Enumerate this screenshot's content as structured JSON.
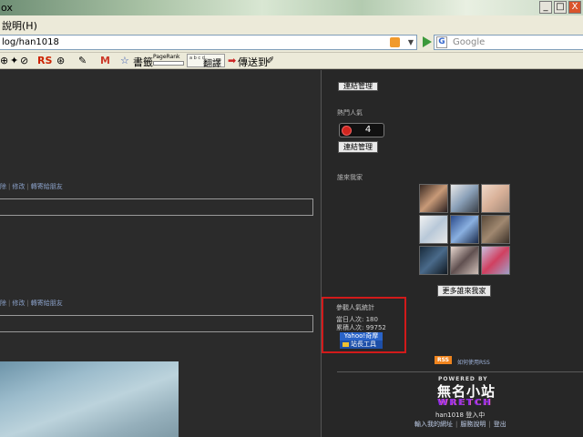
{
  "window": {
    "title": "ox",
    "controls": [
      "_",
      "□",
      "X"
    ]
  },
  "menu": {
    "help": "說明",
    "help_key": "(H)"
  },
  "navbar": {
    "url": "log/han1018",
    "search_placeholder": "Google",
    "g_letter": "G"
  },
  "toolbar": {
    "rs": "RS",
    "m": "M",
    "bookmarks": "書籤",
    "pagerank": "PageRank",
    "translate": "翻譯",
    "translate_mini": "a b  c d",
    "send": "傳送到"
  },
  "main": {
    "links1": [
      "除",
      "修改",
      "轉寄給朋友"
    ],
    "links2": [
      "除",
      "修改",
      "轉寄給朋友"
    ]
  },
  "sidebar": {
    "link_manage_top": "連結管理",
    "popular_title": "熱門人氣",
    "counter_value": "4",
    "link_manage": "連結管理",
    "visitors_title": "誰來我家",
    "more_visitors": "更多誰來我家",
    "stats": {
      "title": "參觀人氣統計",
      "today": "當日人次: 180",
      "total": "累積人次: 99752",
      "yahoo": "Yahoo!奇摩",
      "tools": "站長工具"
    },
    "rss_badge": "RSS",
    "rss_text": "如何使用RSS"
  },
  "footer": {
    "powered_by": "POWERED BY",
    "logo_top": "無名小站",
    "logo_bottom": "WRETCH",
    "online": "han1018 登入中",
    "links": [
      "輸入我的網址",
      "服務說明",
      "登出"
    ]
  },
  "colors": {
    "stat_border": "#d21a1a",
    "rss": "#f0841e",
    "yahoo": "#2a64c8",
    "background": "#2b2b2b"
  }
}
